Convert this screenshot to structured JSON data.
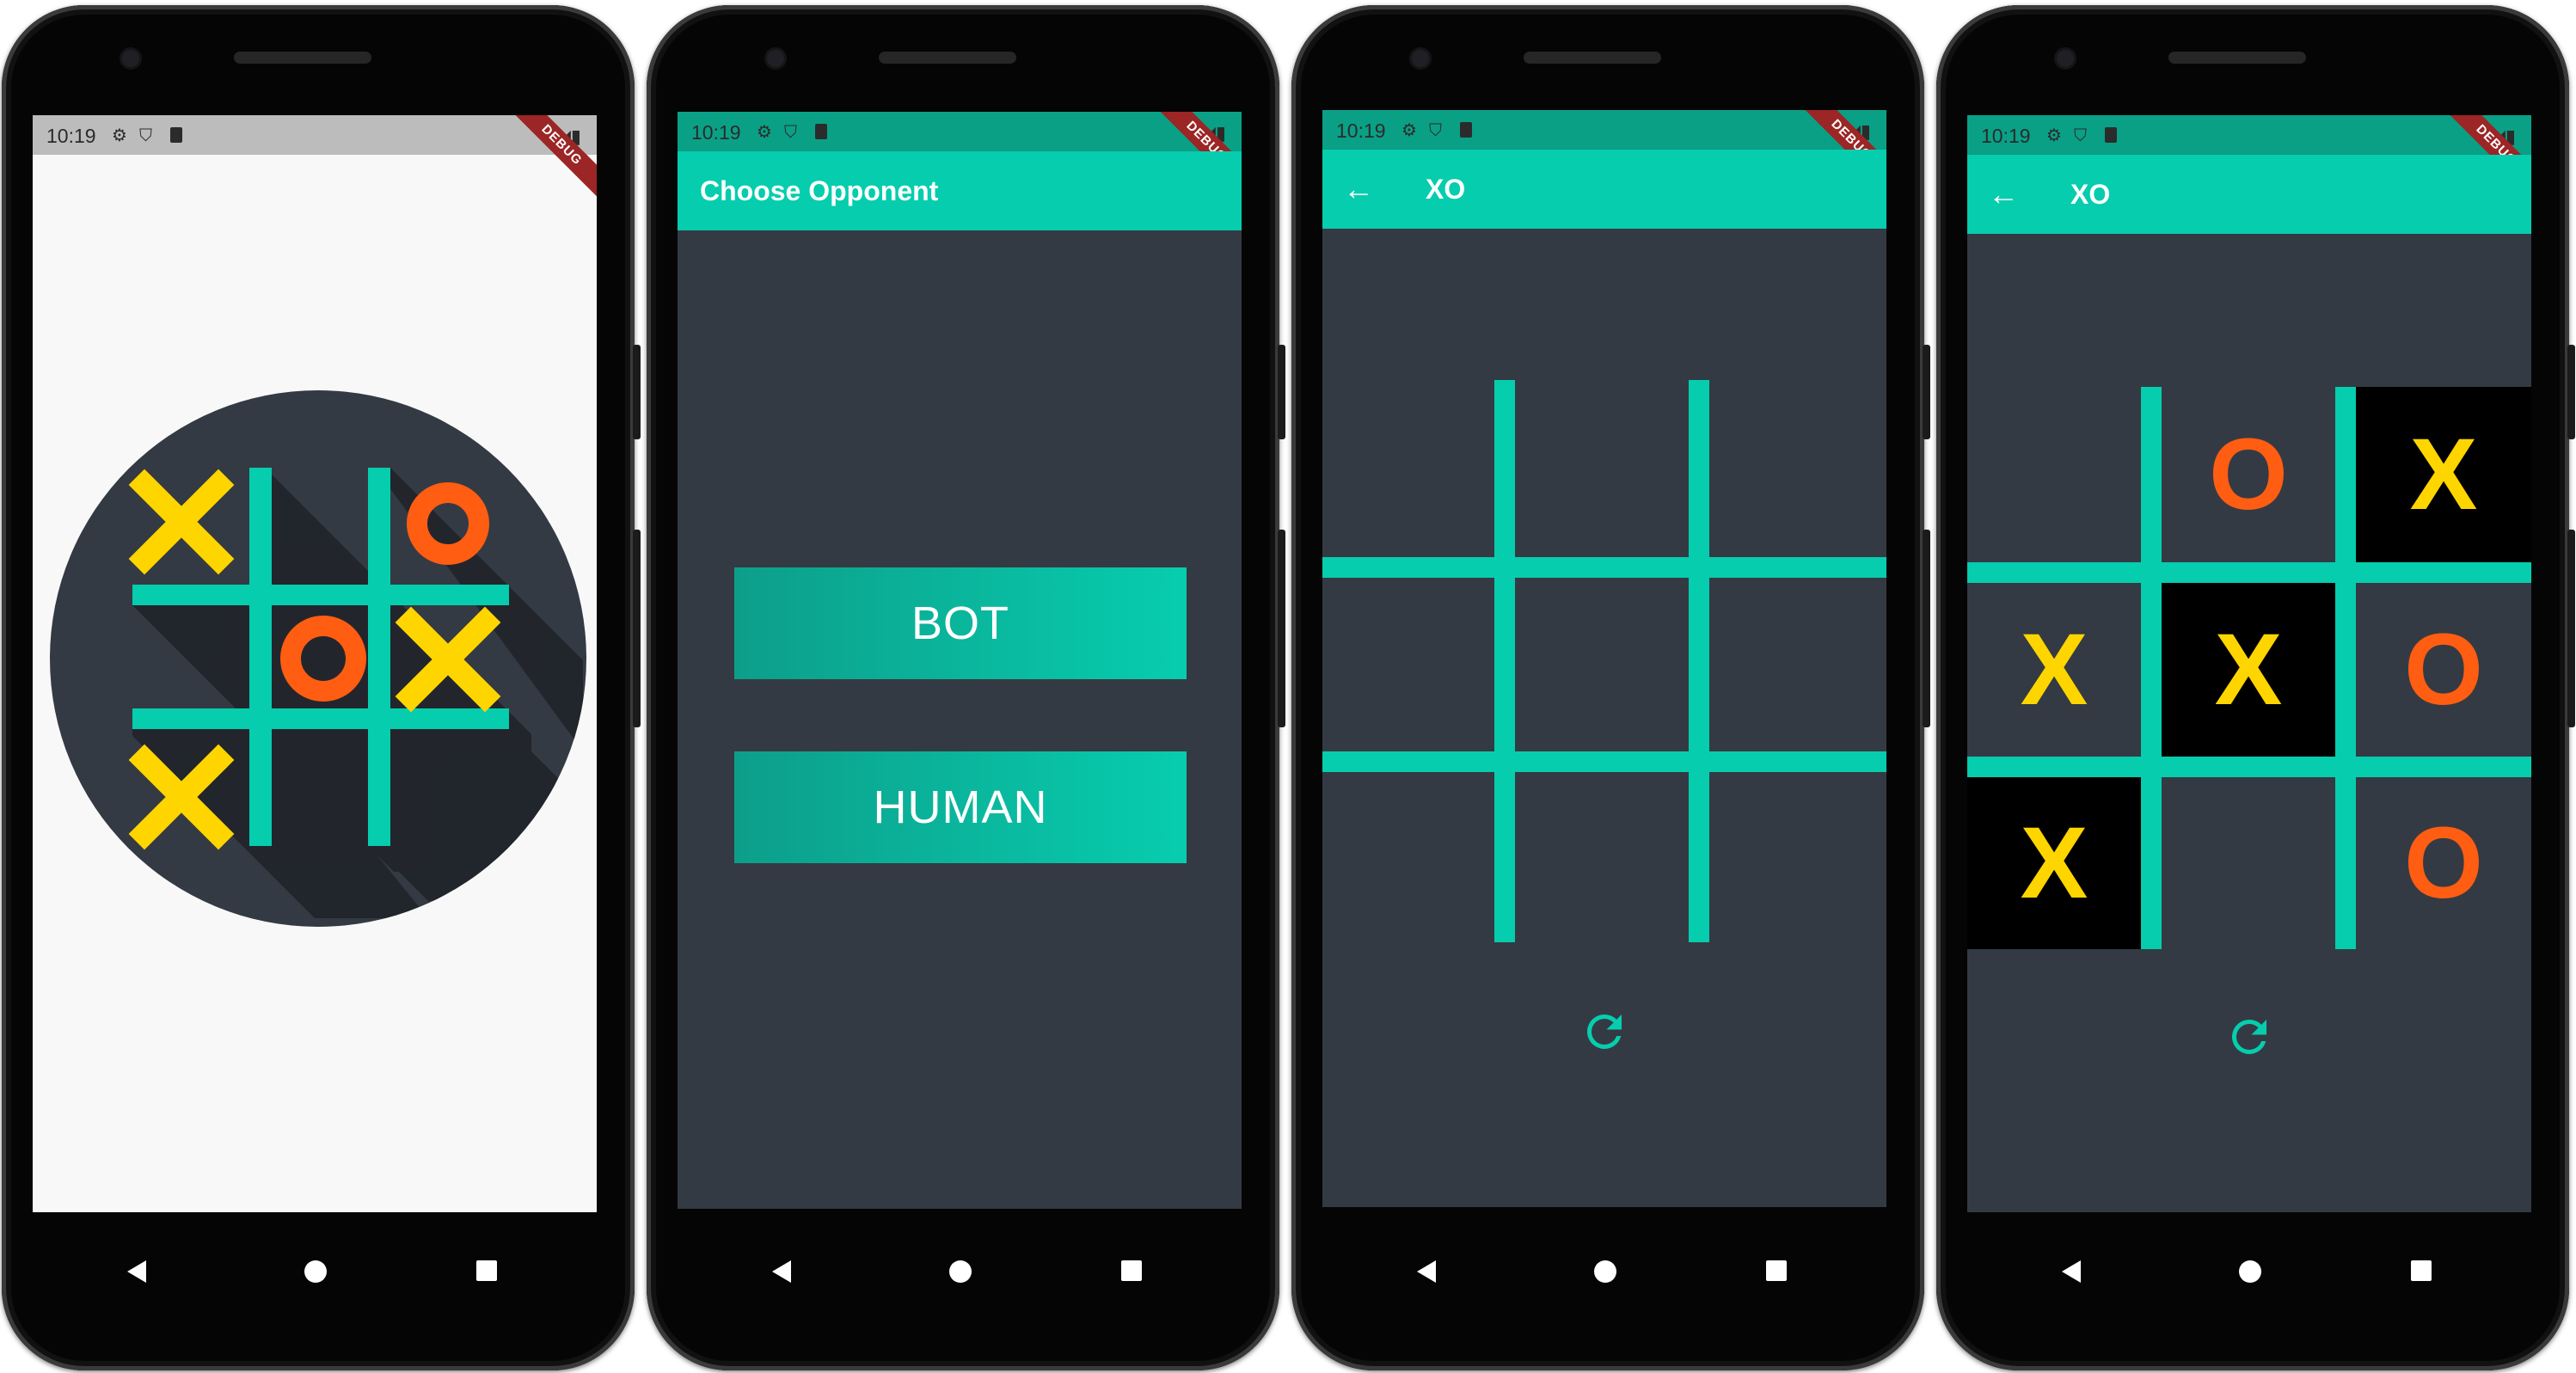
{
  "status_bar": {
    "time": "10:19",
    "debug_banner": "DEBUG"
  },
  "colors": {
    "accent": "#05cdae",
    "background": "#343a43",
    "x_mark": "#ffd500",
    "o_mark": "#ff5d12",
    "splash_bg": "#f8f8f8",
    "dark_cell": "#000000"
  },
  "screen1": {
    "logo": "tic-tac-toe-logo"
  },
  "screen2": {
    "appbar_title": "Choose Opponent",
    "options": [
      "BOT",
      "HUMAN"
    ]
  },
  "screen3": {
    "appbar_title": "XO",
    "back_icon": "arrow-back-icon",
    "board": [
      "",
      "",
      "",
      "",
      "",
      "",
      "",
      "",
      ""
    ],
    "refresh_icon": "refresh-icon"
  },
  "screen4": {
    "appbar_title": "XO",
    "back_icon": "arrow-back-icon",
    "board": [
      "",
      "O",
      "X",
      "X",
      "X",
      "O",
      "X",
      "",
      "O"
    ],
    "highlighted_cells": [
      2,
      4,
      6
    ],
    "refresh_icon": "refresh-icon"
  },
  "nav": {
    "back": "nav-back-icon",
    "home": "nav-home-icon",
    "recents": "nav-recents-icon"
  }
}
